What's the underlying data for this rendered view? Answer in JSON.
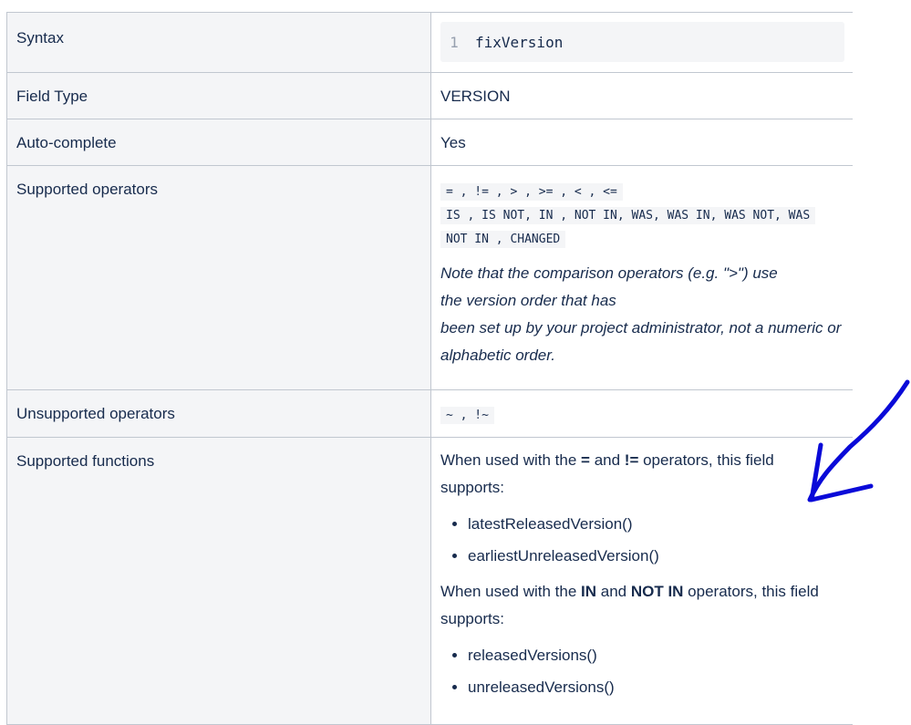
{
  "rows": {
    "syntax": {
      "label": "Syntax",
      "line_number": "1",
      "code": "fixVersion"
    },
    "field_type": {
      "label": "Field Type",
      "value": "VERSION"
    },
    "auto_complete": {
      "label": "Auto-complete",
      "value": "Yes"
    },
    "supported_operators": {
      "label": "Supported operators",
      "op_lines": [
        "= , != , > , >= , < , <=",
        "IS , IS NOT, IN , NOT IN, WAS, WAS IN, WAS NOT, WAS",
        "NOT IN , CHANGED"
      ],
      "note_lines": [
        "Note that the comparison operators (e.g. \">\") use",
        "the version order that has",
        "been set up by your project administrator, not a numeric or",
        "alphabetic order."
      ]
    },
    "unsupported_operators": {
      "label": "Unsupported operators",
      "value": "~ , !~"
    },
    "supported_functions": {
      "label": "Supported functions",
      "para1": {
        "pre": "When used with the ",
        "op1": "=",
        "mid": " and ",
        "op2": "!=",
        "post": " operators, this field",
        "line2": "supports:"
      },
      "list1": [
        "latestReleasedVersion()",
        "earliestUnreleasedVersion()"
      ],
      "para2": {
        "pre": "When used with the ",
        "op1": "IN",
        "mid": " and ",
        "op2": "NOT IN",
        "post": " operators, this field",
        "line2": "supports:"
      },
      "list2": [
        "releasedVersions()",
        "unreleasedVersions()"
      ]
    }
  },
  "annotation": {
    "color": "#0a0ad8",
    "icon": "hand-drawn-arrow-icon"
  }
}
